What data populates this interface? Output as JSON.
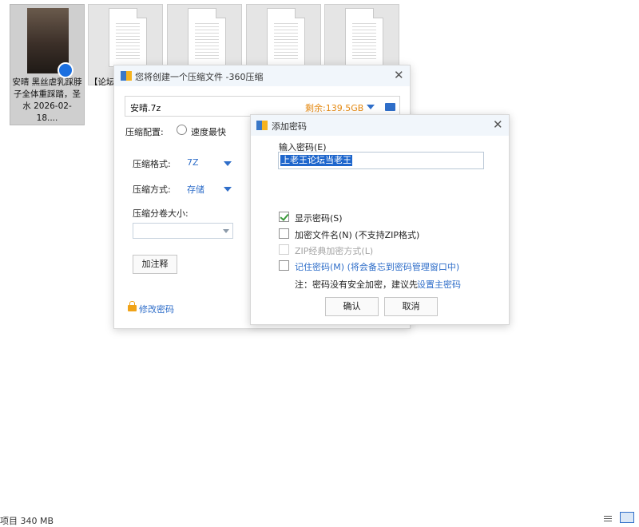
{
  "explorer": {
    "files": [
      {
        "caption": "安晴 黑丝虐乳踩脖子全体重踩踏，圣水 2026-02-18...."
      },
      {
        "caption": "【论坛"
      },
      {
        "caption": ""
      },
      {
        "caption": ""
      },
      {
        "caption": ""
      }
    ]
  },
  "compress_window": {
    "title": "您将创建一个压缩文件 -360压缩",
    "close": "✕",
    "archive_name": "安晴.7z",
    "free_space": "剩余:139.5GB",
    "config_label": "压缩配置:",
    "speed_option": "速度最快",
    "format_label": "压缩格式:",
    "format_value": "7Z",
    "method_label": "压缩方式:",
    "method_value": "存储",
    "split_label": "压缩分卷大小:",
    "comment_button": "加注释",
    "change_password": "修改密码"
  },
  "password_dialog": {
    "title": "添加密码",
    "close": "✕",
    "input_label": "输入密码(E)",
    "password_value": "上老王论坛当老王",
    "show_password": "显示密码(S)",
    "encrypt_filenames": "加密文件名(N) (不支持ZIP格式)",
    "zip_classic": "ZIP经典加密方式(L)",
    "remember_password": "记住密码(M) (将会备忘到密码管理窗口中)",
    "note": "注：密码没有安全加密，建议先",
    "note_link": "设置主密码",
    "ok": "确认",
    "cancel": "取消"
  },
  "status_bar": {
    "text": "项目 340 MB"
  },
  "colors": {
    "accent": "#2f6ec9",
    "free_space": "#e58a13",
    "selection": "#1e66cc"
  }
}
